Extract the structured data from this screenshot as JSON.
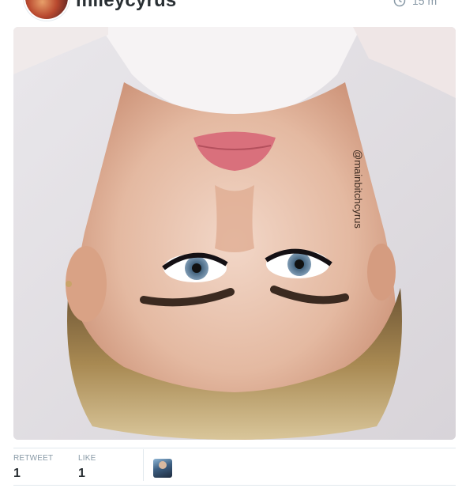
{
  "tweet": {
    "username": "mileycyrus",
    "time": "15 m",
    "photo": {
      "watermark": "@mainbitchcyrus"
    },
    "stats": {
      "retweet_label": "RETWEET",
      "retweet_count": "1",
      "like_label": "LIKE",
      "like_count": "1"
    },
    "icons": {
      "time": "clock-icon",
      "avatar": "profile-avatar",
      "liker": "liker-avatar"
    }
  },
  "colors": {
    "text": "#292f33",
    "muted": "#8899a6",
    "divider": "#e1e8ed"
  }
}
